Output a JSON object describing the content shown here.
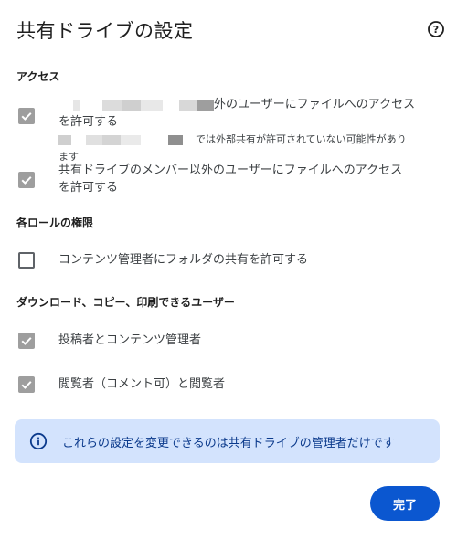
{
  "dialog": {
    "title": "共有ドライブの設定",
    "help_icon": "help-circle-icon"
  },
  "access": {
    "heading": "アクセス",
    "external_sharing": {
      "label_suffix": "外のユーザーにファイルへのアクセス",
      "label_line2": "を許可する",
      "note_suffix": "では外部共有が許可されていない可能性があり",
      "note_line2": "ます",
      "checked": true
    },
    "non_member_access": {
      "label_line1": "共有ドライブのメンバー以外のユーザーにファイルへのアクセス",
      "label_line2": "を許可する",
      "checked": true
    }
  },
  "role_permissions": {
    "heading": "各ロールの権限",
    "content_manager_folder_sharing": {
      "label": "コンテンツ管理者にフォルダの共有を許可する",
      "checked": false
    }
  },
  "download_copy_print": {
    "heading": "ダウンロード、コピー、印刷できるユーザー",
    "contributors": {
      "label": "投稿者とコンテンツ管理者",
      "checked": true
    },
    "viewers": {
      "label": "閲覧者（コメント可）と閲覧者",
      "checked": true
    }
  },
  "info_banner": {
    "text": "これらの設定を変更できるのは共有ドライブの管理者だけです",
    "icon": "info-icon"
  },
  "done_button": {
    "label": "完了"
  },
  "colors": {
    "accent": "#0b57d0",
    "banner_bg": "#d3e3fd",
    "banner_text": "#0b3a8c",
    "checkbox_disabled": "#9e9e9e"
  }
}
